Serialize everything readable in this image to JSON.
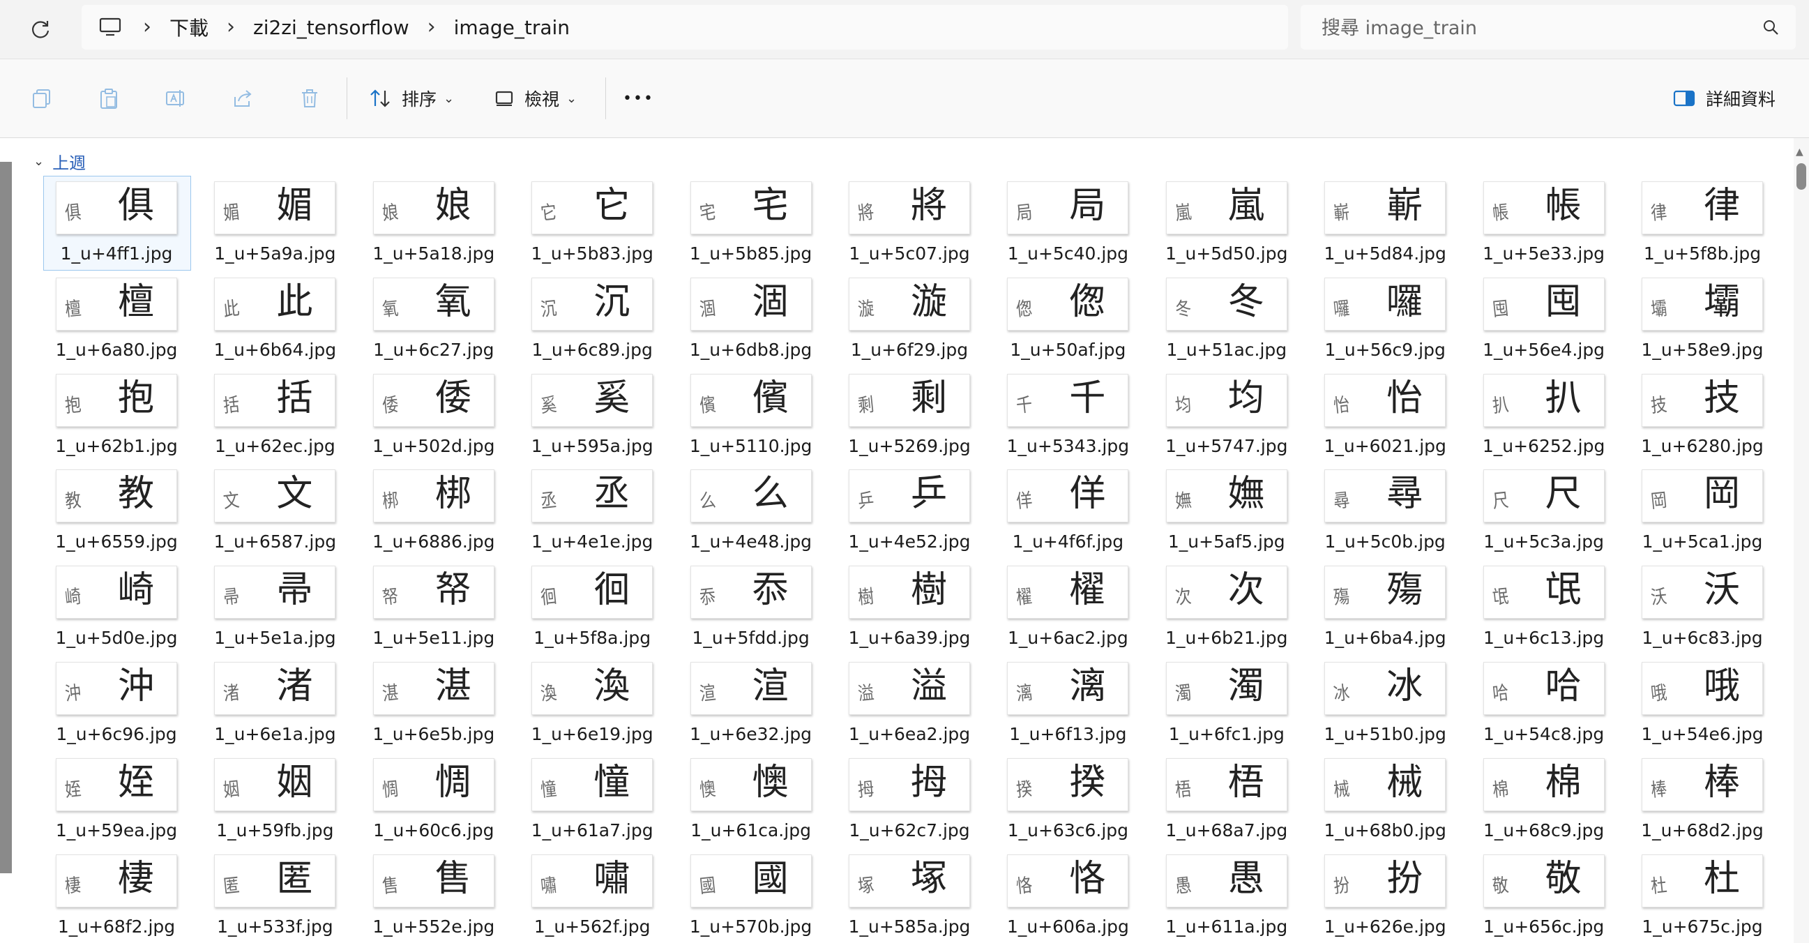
{
  "address_bar": {
    "breadcrumbs": [
      "下載",
      "zi2zi_tensorflow",
      "image_train"
    ],
    "search_placeholder": "搜尋 image_train"
  },
  "toolbar": {
    "sort_label": "排序",
    "view_label": "檢視",
    "more_label": "•••",
    "details_label": "詳細資料",
    "accent_color": "#1a73c7"
  },
  "group": {
    "label": "上週"
  },
  "files": [
    {
      "small": "俱",
      "big": "俱",
      "name": "1_u+4ff1.jpg"
    },
    {
      "small": "媚",
      "big": "媚",
      "name": "1_u+5a9a.jpg"
    },
    {
      "small": "娘",
      "big": "娘",
      "name": "1_u+5a18.jpg"
    },
    {
      "small": "它",
      "big": "它",
      "name": "1_u+5b83.jpg"
    },
    {
      "small": "宅",
      "big": "宅",
      "name": "1_u+5b85.jpg"
    },
    {
      "small": "將",
      "big": "將",
      "name": "1_u+5c07.jpg"
    },
    {
      "small": "局",
      "big": "局",
      "name": "1_u+5c40.jpg"
    },
    {
      "small": "嵐",
      "big": "嵐",
      "name": "1_u+5d50.jpg"
    },
    {
      "small": "嶄",
      "big": "嶄",
      "name": "1_u+5d84.jpg"
    },
    {
      "small": "帳",
      "big": "帳",
      "name": "1_u+5e33.jpg"
    },
    {
      "small": "律",
      "big": "律",
      "name": "1_u+5f8b.jpg"
    },
    {
      "small": "檀",
      "big": "檀",
      "name": "1_u+6a80.jpg"
    },
    {
      "small": "此",
      "big": "此",
      "name": "1_u+6b64.jpg"
    },
    {
      "small": "氧",
      "big": "氧",
      "name": "1_u+6c27.jpg"
    },
    {
      "small": "沉",
      "big": "沉",
      "name": "1_u+6c89.jpg"
    },
    {
      "small": "涸",
      "big": "涸",
      "name": "1_u+6db8.jpg"
    },
    {
      "small": "漩",
      "big": "漩",
      "name": "1_u+6f29.jpg"
    },
    {
      "small": "偬",
      "big": "偬",
      "name": "1_u+50af.jpg"
    },
    {
      "small": "冬",
      "big": "冬",
      "name": "1_u+51ac.jpg"
    },
    {
      "small": "囉",
      "big": "囉",
      "name": "1_u+56c9.jpg"
    },
    {
      "small": "囤",
      "big": "囤",
      "name": "1_u+56e4.jpg"
    },
    {
      "small": "壩",
      "big": "壩",
      "name": "1_u+58e9.jpg"
    },
    {
      "small": "抱",
      "big": "抱",
      "name": "1_u+62b1.jpg"
    },
    {
      "small": "括",
      "big": "括",
      "name": "1_u+62ec.jpg"
    },
    {
      "small": "倭",
      "big": "倭",
      "name": "1_u+502d.jpg"
    },
    {
      "small": "奚",
      "big": "奚",
      "name": "1_u+595a.jpg"
    },
    {
      "small": "儐",
      "big": "儐",
      "name": "1_u+5110.jpg"
    },
    {
      "small": "剩",
      "big": "剩",
      "name": "1_u+5269.jpg"
    },
    {
      "small": "千",
      "big": "千",
      "name": "1_u+5343.jpg"
    },
    {
      "small": "均",
      "big": "均",
      "name": "1_u+5747.jpg"
    },
    {
      "small": "怡",
      "big": "怡",
      "name": "1_u+6021.jpg"
    },
    {
      "small": "扒",
      "big": "扒",
      "name": "1_u+6252.jpg"
    },
    {
      "small": "技",
      "big": "技",
      "name": "1_u+6280.jpg"
    },
    {
      "small": "教",
      "big": "教",
      "name": "1_u+6559.jpg"
    },
    {
      "small": "文",
      "big": "文",
      "name": "1_u+6587.jpg"
    },
    {
      "small": "梆",
      "big": "梆",
      "name": "1_u+6886.jpg"
    },
    {
      "small": "丞",
      "big": "丞",
      "name": "1_u+4e1e.jpg"
    },
    {
      "small": "么",
      "big": "么",
      "name": "1_u+4e48.jpg"
    },
    {
      "small": "乒",
      "big": "乒",
      "name": "1_u+4e52.jpg"
    },
    {
      "small": "佯",
      "big": "佯",
      "name": "1_u+4f6f.jpg"
    },
    {
      "small": "嫵",
      "big": "嫵",
      "name": "1_u+5af5.jpg"
    },
    {
      "small": "尋",
      "big": "尋",
      "name": "1_u+5c0b.jpg"
    },
    {
      "small": "尺",
      "big": "尺",
      "name": "1_u+5c3a.jpg"
    },
    {
      "small": "岡",
      "big": "岡",
      "name": "1_u+5ca1.jpg"
    },
    {
      "small": "崎",
      "big": "崎",
      "name": "1_u+5d0e.jpg"
    },
    {
      "small": "帚",
      "big": "帚",
      "name": "1_u+5e1a.jpg"
    },
    {
      "small": "帑",
      "big": "帑",
      "name": "1_u+5e11.jpg"
    },
    {
      "small": "徊",
      "big": "徊",
      "name": "1_u+5f8a.jpg"
    },
    {
      "small": "忝",
      "big": "忝",
      "name": "1_u+5fdd.jpg"
    },
    {
      "small": "樹",
      "big": "樹",
      "name": "1_u+6a39.jpg"
    },
    {
      "small": "櫂",
      "big": "櫂",
      "name": "1_u+6ac2.jpg"
    },
    {
      "small": "次",
      "big": "次",
      "name": "1_u+6b21.jpg"
    },
    {
      "small": "殤",
      "big": "殤",
      "name": "1_u+6ba4.jpg"
    },
    {
      "small": "氓",
      "big": "氓",
      "name": "1_u+6c13.jpg"
    },
    {
      "small": "沃",
      "big": "沃",
      "name": "1_u+6c83.jpg"
    },
    {
      "small": "沖",
      "big": "沖",
      "name": "1_u+6c96.jpg"
    },
    {
      "small": "渚",
      "big": "渚",
      "name": "1_u+6e1a.jpg"
    },
    {
      "small": "湛",
      "big": "湛",
      "name": "1_u+6e5b.jpg"
    },
    {
      "small": "渙",
      "big": "渙",
      "name": "1_u+6e19.jpg"
    },
    {
      "small": "渲",
      "big": "渲",
      "name": "1_u+6e32.jpg"
    },
    {
      "small": "溢",
      "big": "溢",
      "name": "1_u+6ea2.jpg"
    },
    {
      "small": "漓",
      "big": "漓",
      "name": "1_u+6f13.jpg"
    },
    {
      "small": "濁",
      "big": "濁",
      "name": "1_u+6fc1.jpg"
    },
    {
      "small": "冰",
      "big": "冰",
      "name": "1_u+51b0.jpg"
    },
    {
      "small": "哈",
      "big": "哈",
      "name": "1_u+54c8.jpg"
    },
    {
      "small": "哦",
      "big": "哦",
      "name": "1_u+54e6.jpg"
    },
    {
      "small": "姪",
      "big": "姪",
      "name": "1_u+59ea.jpg"
    },
    {
      "small": "姻",
      "big": "姻",
      "name": "1_u+59fb.jpg"
    },
    {
      "small": "惆",
      "big": "惆",
      "name": "1_u+60c6.jpg"
    },
    {
      "small": "憧",
      "big": "憧",
      "name": "1_u+61a7.jpg"
    },
    {
      "small": "懊",
      "big": "懊",
      "name": "1_u+61ca.jpg"
    },
    {
      "small": "拇",
      "big": "拇",
      "name": "1_u+62c7.jpg"
    },
    {
      "small": "揆",
      "big": "揆",
      "name": "1_u+63c6.jpg"
    },
    {
      "small": "梧",
      "big": "梧",
      "name": "1_u+68a7.jpg"
    },
    {
      "small": "械",
      "big": "械",
      "name": "1_u+68b0.jpg"
    },
    {
      "small": "棉",
      "big": "棉",
      "name": "1_u+68c9.jpg"
    },
    {
      "small": "棒",
      "big": "棒",
      "name": "1_u+68d2.jpg"
    },
    {
      "small": "棲",
      "big": "棲",
      "name": "1_u+68f2.jpg"
    },
    {
      "small": "匿",
      "big": "匿",
      "name": "1_u+533f.jpg"
    },
    {
      "small": "售",
      "big": "售",
      "name": "1_u+552e.jpg"
    },
    {
      "small": "嘯",
      "big": "嘯",
      "name": "1_u+562f.jpg"
    },
    {
      "small": "國",
      "big": "國",
      "name": "1_u+570b.jpg"
    },
    {
      "small": "塚",
      "big": "塚",
      "name": "1_u+585a.jpg"
    },
    {
      "small": "恪",
      "big": "恪",
      "name": "1_u+606a.jpg"
    },
    {
      "small": "愚",
      "big": "愚",
      "name": "1_u+611a.jpg"
    },
    {
      "small": "扮",
      "big": "扮",
      "name": "1_u+626e.jpg"
    },
    {
      "small": "敬",
      "big": "敬",
      "name": "1_u+656c.jpg"
    },
    {
      "small": "杜",
      "big": "杜",
      "name": "1_u+675c.jpg"
    }
  ]
}
